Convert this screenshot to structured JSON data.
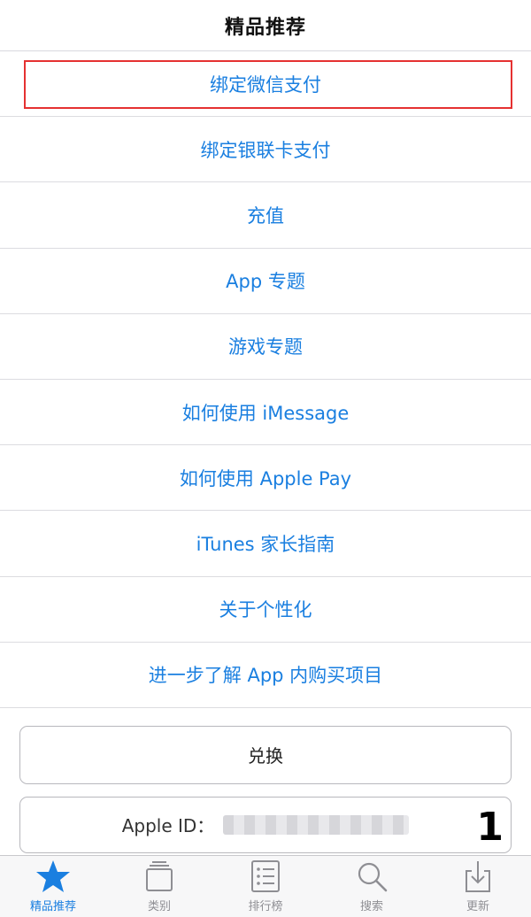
{
  "header": {
    "title": "精品推荐"
  },
  "list": [
    {
      "label": "绑定微信支付"
    },
    {
      "label": "绑定银联卡支付"
    },
    {
      "label": "充值"
    },
    {
      "label": "App 专题"
    },
    {
      "label": "游戏专题"
    },
    {
      "label": "如何使用 iMessage"
    },
    {
      "label": "如何使用 Apple Pay"
    },
    {
      "label": "iTunes 家长指南"
    },
    {
      "label": "关于个性化"
    },
    {
      "label": "进一步了解 App 内购买项目"
    }
  ],
  "buttons": {
    "redeem": "兑换",
    "apple_id_label": "Apple ID："
  },
  "annotation": {
    "number": "1",
    "highlight_color": "#e53131"
  },
  "tabs": [
    {
      "label": "精品推荐",
      "icon": "star-icon",
      "active": true
    },
    {
      "label": "类别",
      "icon": "categories-icon",
      "active": false
    },
    {
      "label": "排行榜",
      "icon": "ranking-list-icon",
      "active": false
    },
    {
      "label": "搜索",
      "icon": "search-icon",
      "active": false
    },
    {
      "label": "更新",
      "icon": "update-download-icon",
      "active": false
    }
  ],
  "colors": {
    "accent": "#1a7fe0",
    "inactive": "#8e8e93"
  }
}
